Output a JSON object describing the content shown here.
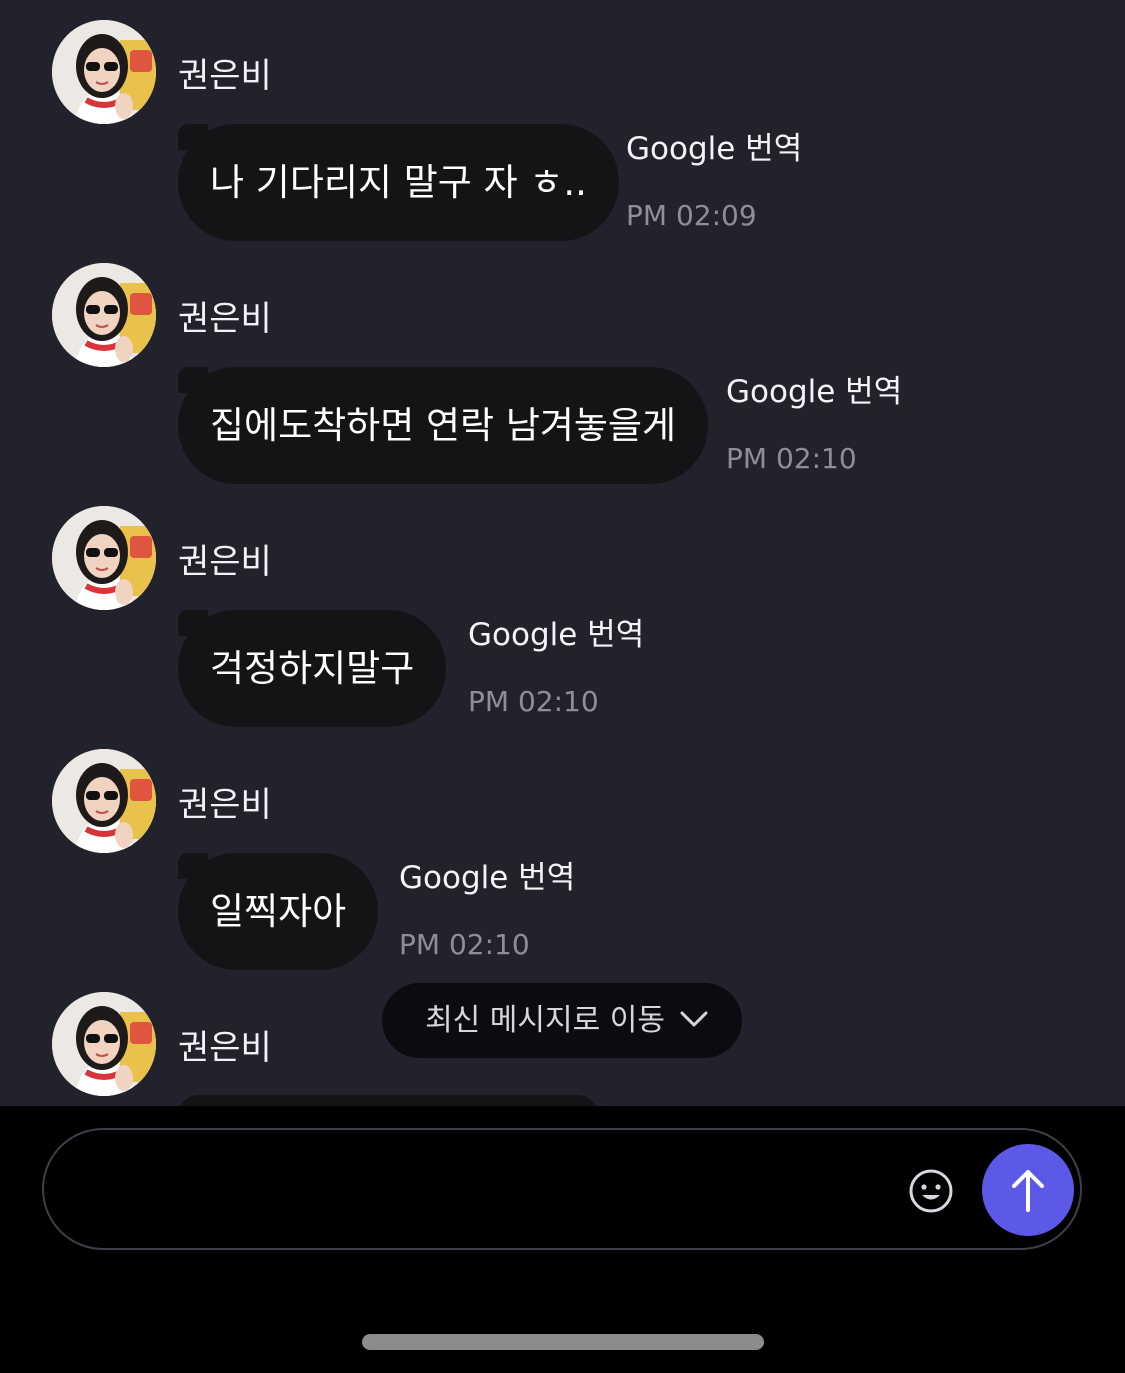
{
  "colors": {
    "chat_background": "#22222c",
    "bubble": "#141417",
    "send_button": "#5d59e8",
    "timestamp": "#8e8e98"
  },
  "messages": [
    {
      "sender": "권은비",
      "text": "나 기다리지 말구 자 ㅎ..",
      "translate": "Google 번역",
      "time": "PM 02:09"
    },
    {
      "sender": "권은비",
      "text": "집에도착하면 연락 남겨놓을게",
      "translate": "Google 번역",
      "time": "PM 02:10"
    },
    {
      "sender": "권은비",
      "text": "걱정하지말구",
      "translate": "Google 번역",
      "time": "PM 02:10"
    },
    {
      "sender": "권은비",
      "text": "일찍자아",
      "translate": "Google 번역",
      "time": "PM 02:10"
    },
    {
      "sender": "권은비"
    }
  ],
  "jump_button": {
    "label": "최신 메시지로 이동",
    "icon": "chevron-down-icon"
  },
  "composer": {
    "placeholder": "",
    "emoji_icon": "smile-icon",
    "send_icon": "arrow-up-icon"
  }
}
